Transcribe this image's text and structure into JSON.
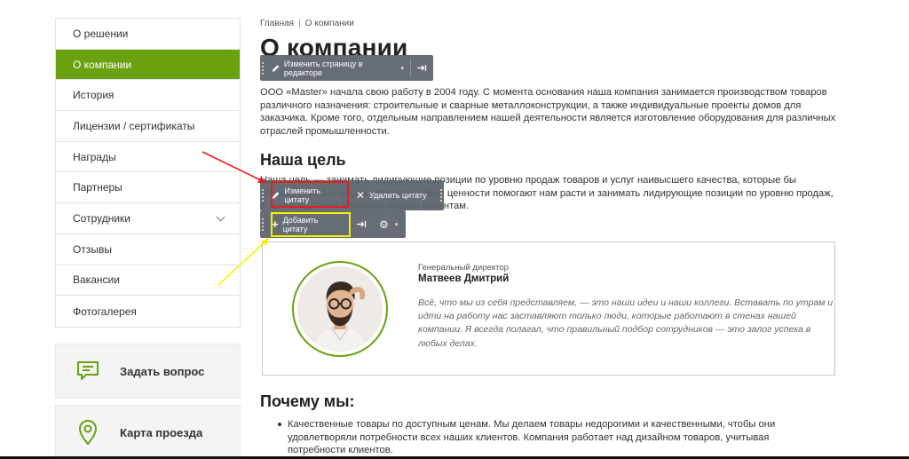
{
  "sidebar": {
    "items": [
      {
        "label": "О решении"
      },
      {
        "label": "О компании"
      },
      {
        "label": "История"
      },
      {
        "label": "Лицензии / сертификаты"
      },
      {
        "label": "Награды"
      },
      {
        "label": "Партнеры"
      },
      {
        "label": "Сотрудники"
      },
      {
        "label": "Отзывы"
      },
      {
        "label": "Вакансии"
      },
      {
        "label": "Фотогалерея"
      }
    ]
  },
  "widgets": {
    "ask": "Задать вопрос",
    "map": "Карта проезда"
  },
  "breadcrumb": {
    "home": "Главная",
    "separator": "|",
    "current": "О компании"
  },
  "page": {
    "title": "О компании",
    "intro": "ООО «Master» начала свою работу в 2004 году. С момента основания наша компания занимается производством товаров различного назначения: строительные и сварные металлоконструкции, а также индивидуальные проекты домов для заказчика. Кроме того, отдельным направлением нашей деятельности является изготовление оборудования для различных отраслей промышленности.",
    "goal_heading": "Наша цель",
    "goal_text": "Наша цель — занимать лидирующие позиции по уровню продаж товаров и услуг наивысшего качества, которые бы улучшали жизнь наших клиентов. Наши ценности помогают нам расти и занимать лидирующие позиции по уровню продаж, а также ощутимо помогают нашим клиентам.",
    "why_heading": "Почему мы:",
    "why_items": [
      "Качественные товары по доступным ценам. Мы делаем товары недорогими и качественными, чтобы они удовлетворяли потребности всех наших клиентов. Компания работает над дизайном товаров, учитывая потребности клиентов."
    ]
  },
  "quote": {
    "role": "Генеральный директор",
    "name": "Матвеев Дмитрий",
    "text": "Всё, что мы из себя представляем, — это наши идеи и наши коллеги. Вставать по утрам и идти на работу нас заставляют только люди, которые работают в стенах нашей компании. Я всегда полагал, что правильный подбор сотрудников — это залог успеха в любых делах."
  },
  "editor": {
    "edit_page": "Изменить страницу в редакторе",
    "edit_quote": "Изменить цитату",
    "delete_quote": "Удалить цитату",
    "add_quote": "Добавить цитату"
  },
  "colors": {
    "accent": "#6aa20f",
    "panel": "#5e646c",
    "highlight_red": "#e51d1d",
    "highlight_yellow": "#f3f300",
    "arrow_red": "#e51d1d",
    "arrow_yellow": "#f3f300"
  }
}
